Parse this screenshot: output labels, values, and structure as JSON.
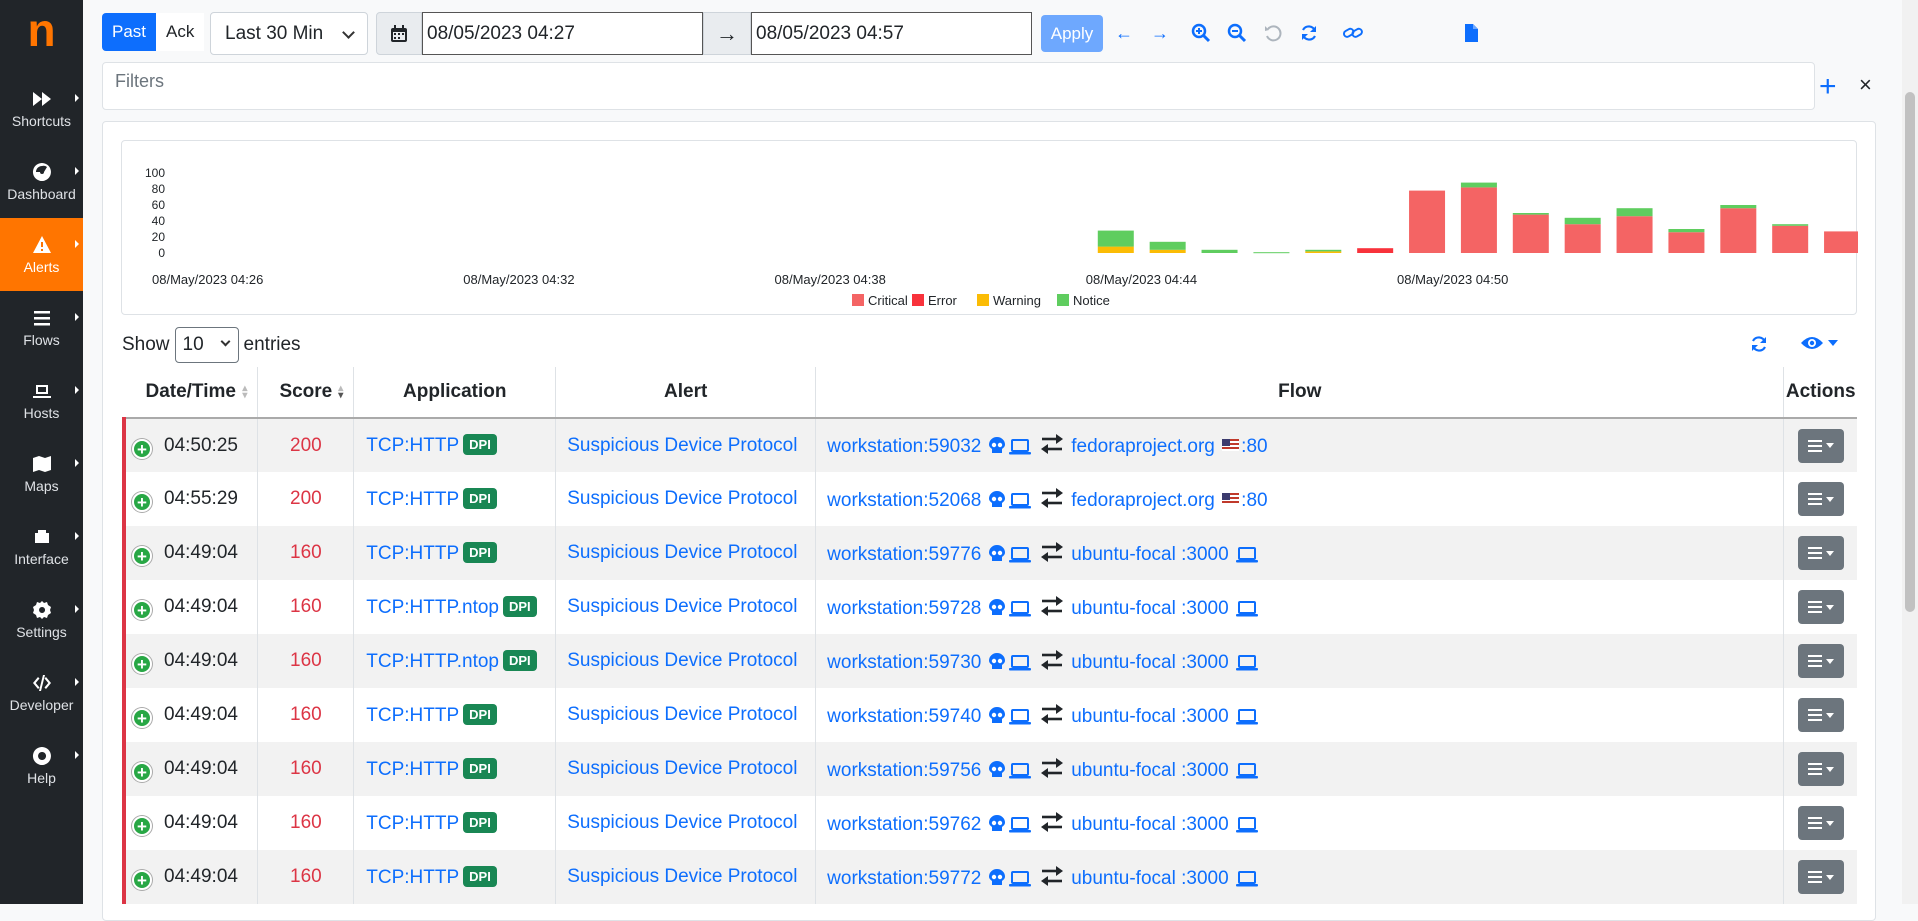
{
  "app": {
    "logo": "n"
  },
  "sidebar": {
    "items": [
      {
        "label": "Shortcuts",
        "icon": "fast-forward-icon"
      },
      {
        "label": "Dashboard",
        "icon": "gauge-icon"
      },
      {
        "label": "Alerts",
        "icon": "warning-icon",
        "active": true
      },
      {
        "label": "Flows",
        "icon": "list-icon"
      },
      {
        "label": "Hosts",
        "icon": "laptop-icon"
      },
      {
        "label": "Maps",
        "icon": "map-icon"
      },
      {
        "label": "Interface",
        "icon": "ethernet-icon"
      },
      {
        "label": "Settings",
        "icon": "gear-icon"
      },
      {
        "label": "Developer",
        "icon": "code-icon"
      },
      {
        "label": "Help",
        "icon": "lifebuoy-icon"
      }
    ]
  },
  "toolbar": {
    "past_label": "Past",
    "ack_label": "Ack",
    "range_value": "Last 30 Min",
    "start_date": "08/05/2023 04:27",
    "end_date": "08/05/2023 04:57",
    "apply_label": "Apply",
    "filters_placeholder": "Filters",
    "add_filter": "+",
    "close_filter": "×"
  },
  "chart_data": {
    "type": "bar",
    "stacked": true,
    "x_tick_labels": [
      "08/May/2023 04:26",
      "08/May/2023 04:32",
      "08/May/2023 04:38",
      "08/May/2023 04:44",
      "08/May/2023 04:50"
    ],
    "y_tick_labels": [
      "100",
      "80",
      "60",
      "40",
      "20",
      "0"
    ],
    "ylim": [
      0,
      100
    ],
    "categories": [
      "04:44",
      "04:45",
      "04:46",
      "04:47",
      "04:48",
      "04:49",
      "04:50",
      "04:51",
      "04:52",
      "04:53",
      "04:54",
      "04:55",
      "04:56",
      "04:57",
      "04:58"
    ],
    "series": [
      {
        "name": "Critical",
        "color": "#f46464",
        "values": [
          0,
          0,
          0,
          0,
          0,
          0,
          78,
          82,
          48,
          36,
          46,
          26,
          56,
          34,
          27
        ]
      },
      {
        "name": "Error",
        "color": "#f8323b",
        "values": [
          0,
          0,
          0,
          0,
          0,
          6,
          0,
          0,
          0,
          0,
          0,
          0,
          0,
          0,
          0
        ]
      },
      {
        "name": "Warning",
        "color": "#fbbc05",
        "values": [
          8,
          4,
          0,
          0,
          2,
          0,
          0,
          0,
          0,
          0,
          0,
          0,
          0,
          0,
          0
        ]
      },
      {
        "name": "Notice",
        "color": "#5fcd5f",
        "values": [
          20,
          10,
          4,
          1,
          2,
          0,
          0,
          6,
          2,
          8,
          10,
          4,
          4,
          2,
          0
        ]
      }
    ],
    "legend_placement": "bottom-center",
    "grid": false
  },
  "table": {
    "show_label": "Show",
    "entries_value": "10",
    "entries_label": "entries",
    "columns": [
      "Date/Time",
      "Score",
      "Application",
      "Alert",
      "Flow",
      "Actions"
    ],
    "dpi_badge": "DPI",
    "rows": [
      {
        "time": "04:50:25",
        "score": "200",
        "app": "TCP:HTTP",
        "alert": "Suspicious Device Protocol",
        "client": "workstation",
        "cport": ":59032",
        "server": "fedoraproject.org",
        "sport": ":80",
        "server_flag": true
      },
      {
        "time": "04:55:29",
        "score": "200",
        "app": "TCP:HTTP",
        "alert": "Suspicious Device Protocol",
        "client": "workstation",
        "cport": ":52068",
        "server": "fedoraproject.org",
        "sport": ":80",
        "server_flag": true
      },
      {
        "time": "04:49:04",
        "score": "160",
        "app": "TCP:HTTP",
        "alert": "Suspicious Device Protocol",
        "client": "workstation",
        "cport": ":59776",
        "server": "ubuntu-focal",
        "sport": ":3000",
        "server_flag": false
      },
      {
        "time": "04:49:04",
        "score": "160",
        "app": "TCP:HTTP.ntop",
        "alert": "Suspicious Device Protocol",
        "client": "workstation",
        "cport": ":59728",
        "server": "ubuntu-focal",
        "sport": ":3000",
        "server_flag": false
      },
      {
        "time": "04:49:04",
        "score": "160",
        "app": "TCP:HTTP.ntop",
        "alert": "Suspicious Device Protocol",
        "client": "workstation",
        "cport": ":59730",
        "server": "ubuntu-focal",
        "sport": ":3000",
        "server_flag": false
      },
      {
        "time": "04:49:04",
        "score": "160",
        "app": "TCP:HTTP",
        "alert": "Suspicious Device Protocol",
        "client": "workstation",
        "cport": ":59740",
        "server": "ubuntu-focal",
        "sport": ":3000",
        "server_flag": false
      },
      {
        "time": "04:49:04",
        "score": "160",
        "app": "TCP:HTTP",
        "alert": "Suspicious Device Protocol",
        "client": "workstation",
        "cport": ":59756",
        "server": "ubuntu-focal",
        "sport": ":3000",
        "server_flag": false
      },
      {
        "time": "04:49:04",
        "score": "160",
        "app": "TCP:HTTP",
        "alert": "Suspicious Device Protocol",
        "client": "workstation",
        "cport": ":59762",
        "server": "ubuntu-focal",
        "sport": ":3000",
        "server_flag": false
      },
      {
        "time": "04:49:04",
        "score": "160",
        "app": "TCP:HTTP",
        "alert": "Suspicious Device Protocol",
        "client": "workstation",
        "cport": ":59772",
        "server": "ubuntu-focal",
        "sport": ":3000",
        "server_flag": false
      }
    ]
  }
}
